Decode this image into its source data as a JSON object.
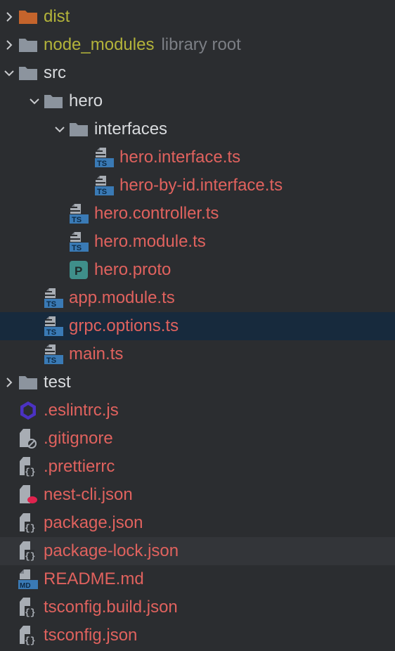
{
  "tree": [
    {
      "label": "dist",
      "kind": "folder",
      "state": "collapsed",
      "color": "olive",
      "icon": "folder-orange-icon",
      "depth": 0
    },
    {
      "label": "node_modules",
      "suffix": "library root",
      "kind": "folder",
      "state": "collapsed",
      "color": "olive",
      "icon": "folder-icon",
      "depth": 0
    },
    {
      "label": "src",
      "kind": "folder",
      "state": "expanded",
      "color": "default",
      "icon": "folder-icon",
      "depth": 0
    },
    {
      "label": "hero",
      "kind": "folder",
      "state": "expanded",
      "color": "default",
      "icon": "folder-icon",
      "depth": 1
    },
    {
      "label": "interfaces",
      "kind": "folder",
      "state": "expanded",
      "color": "default",
      "icon": "folder-icon",
      "depth": 2
    },
    {
      "label": "hero.interface.ts",
      "kind": "file",
      "color": "red",
      "icon": "typescript-file-icon",
      "depth": 3
    },
    {
      "label": "hero-by-id.interface.ts",
      "kind": "file",
      "color": "red",
      "icon": "typescript-file-icon",
      "depth": 3
    },
    {
      "label": "hero.controller.ts",
      "kind": "file",
      "color": "red",
      "icon": "typescript-file-icon",
      "depth": 2
    },
    {
      "label": "hero.module.ts",
      "kind": "file",
      "color": "red",
      "icon": "typescript-file-icon",
      "depth": 2
    },
    {
      "label": "hero.proto",
      "kind": "file",
      "color": "red",
      "icon": "proto-file-icon",
      "depth": 2
    },
    {
      "label": "app.module.ts",
      "kind": "file",
      "color": "red",
      "icon": "typescript-file-icon",
      "depth": 1
    },
    {
      "label": "grpc.options.ts",
      "kind": "file",
      "color": "red",
      "icon": "typescript-file-icon",
      "depth": 1,
      "selected": true
    },
    {
      "label": "main.ts",
      "kind": "file",
      "color": "red",
      "icon": "typescript-file-icon",
      "depth": 1
    },
    {
      "label": "test",
      "kind": "folder",
      "state": "collapsed",
      "color": "default",
      "icon": "folder-icon",
      "depth": 0
    },
    {
      "label": ".eslintrc.js",
      "kind": "file",
      "color": "red",
      "icon": "eslint-file-icon",
      "depth": 0
    },
    {
      "label": ".gitignore",
      "kind": "file",
      "color": "red",
      "icon": "gitignore-file-icon",
      "depth": 0
    },
    {
      "label": ".prettierrc",
      "kind": "file",
      "color": "red",
      "icon": "json-file-icon",
      "depth": 0
    },
    {
      "label": "nest-cli.json",
      "kind": "file",
      "color": "red",
      "icon": "nest-file-icon",
      "depth": 0
    },
    {
      "label": "package.json",
      "kind": "file",
      "color": "red",
      "icon": "json-file-icon",
      "depth": 0
    },
    {
      "label": "package-lock.json",
      "kind": "file",
      "color": "red",
      "icon": "json-file-icon",
      "depth": 0,
      "hover": true
    },
    {
      "label": "README.md",
      "kind": "file",
      "color": "red",
      "icon": "markdown-file-icon",
      "depth": 0
    },
    {
      "label": "tsconfig.build.json",
      "kind": "file",
      "color": "red",
      "icon": "json-file-icon",
      "depth": 0
    },
    {
      "label": "tsconfig.json",
      "kind": "file",
      "color": "red",
      "icon": "json-file-icon",
      "depth": 0
    }
  ],
  "colors": {
    "background": "#2b2d30",
    "selected": "#172a3d",
    "hover": "#333539",
    "text": "#d9dbde",
    "modified": "#e0625e",
    "excluded": "#b3b33a",
    "muted": "#7c7f85",
    "folder": "#8c949e",
    "folder_orange": "#c4642c",
    "typescript": "#3a7ab5"
  }
}
